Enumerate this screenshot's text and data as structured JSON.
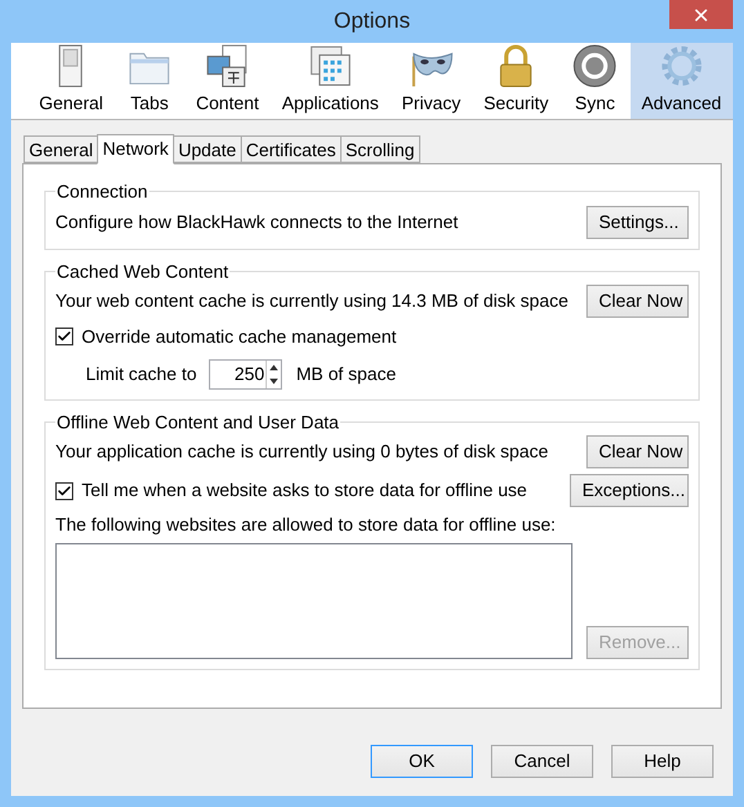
{
  "window": {
    "title": "Options"
  },
  "categories": [
    {
      "label": "General",
      "selected": false
    },
    {
      "label": "Tabs",
      "selected": false
    },
    {
      "label": "Content",
      "selected": false
    },
    {
      "label": "Applications",
      "selected": false
    },
    {
      "label": "Privacy",
      "selected": false
    },
    {
      "label": "Security",
      "selected": false
    },
    {
      "label": "Sync",
      "selected": false
    },
    {
      "label": "Advanced",
      "selected": true
    }
  ],
  "tabs": [
    {
      "label": "General",
      "selected": false
    },
    {
      "label": "Network",
      "selected": true
    },
    {
      "label": "Update",
      "selected": false
    },
    {
      "label": "Certificates",
      "selected": false
    },
    {
      "label": "Scrolling",
      "selected": false
    }
  ],
  "connection": {
    "title": "Connection",
    "text": "Configure how BlackHawk connects to the Internet",
    "button": "Settings..."
  },
  "cached_web_content": {
    "title": "Cached Web Content",
    "text": "Your web content cache is currently using 14.3 MB of disk space",
    "button": "Clear Now",
    "override": {
      "label": "Override automatic cache management",
      "checked": true
    },
    "limit": {
      "label": "Limit cache to",
      "value": "250",
      "unit": "MB of space"
    }
  },
  "offline": {
    "title": "Offline Web Content and User Data",
    "text": "Your application cache is currently using 0 bytes of disk space",
    "button": "Clear Now",
    "tell_me": {
      "label": "Tell me when a website asks to store data for offline use",
      "checked": true
    },
    "exceptions_button": "Exceptions...",
    "list_label": "The following websites are allowed to store data for offline use:",
    "remove_button": {
      "label": "Remove...",
      "disabled": true
    }
  },
  "buttons": [
    {
      "label": "OK",
      "default": true
    },
    {
      "label": "Cancel",
      "default": false
    },
    {
      "label": "Help",
      "default": false
    }
  ]
}
